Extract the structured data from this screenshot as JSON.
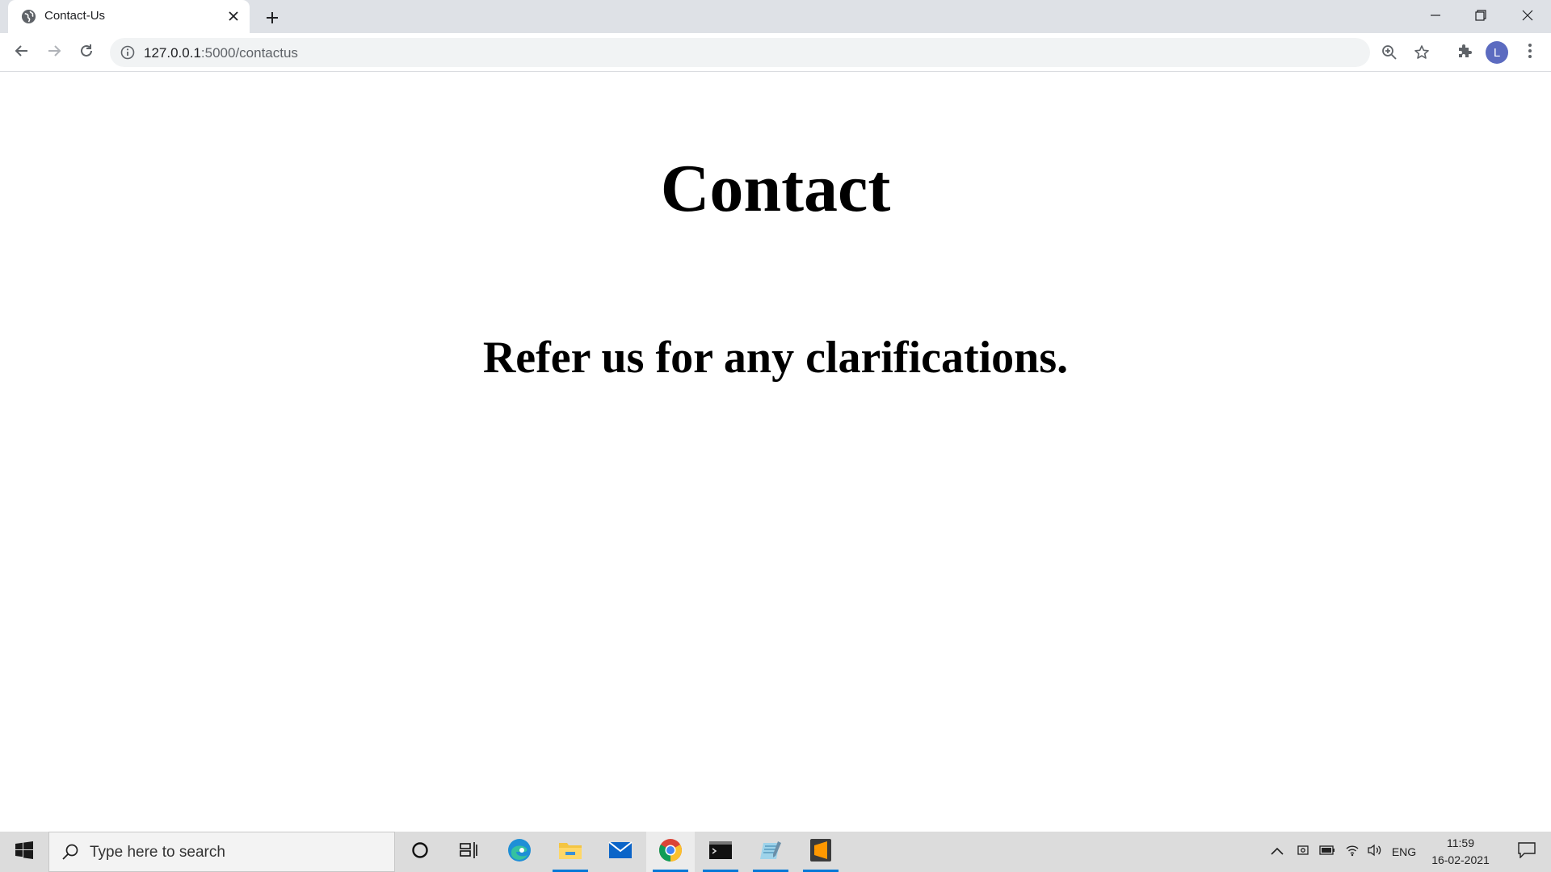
{
  "browser": {
    "tab_title": "Contact-Us",
    "url_host": "127.0.0.1",
    "url_path": ":5000/contactus",
    "profile_initial": "L",
    "icons": {
      "favicon": "globe-icon",
      "back": "back-arrow-icon",
      "forward": "forward-arrow-icon",
      "reload": "reload-icon",
      "site_info": "info-icon",
      "zoom": "zoom-icon",
      "bookmark": "star-icon",
      "extensions": "puzzle-icon",
      "menu": "kebab-menu-icon"
    }
  },
  "page": {
    "heading": "Contact",
    "subheading": "Refer us for any clarifications."
  },
  "taskbar": {
    "search_placeholder": "Type here to search",
    "language": "ENG",
    "time": "11:59",
    "date": "16-02-2021",
    "apps": [
      "cortana-icon",
      "task-view-icon",
      "edge-icon",
      "file-explorer-icon",
      "mail-icon",
      "chrome-icon",
      "terminal-icon",
      "notepad-icon",
      "sublime-text-icon"
    ],
    "accent": "#0078d7"
  }
}
